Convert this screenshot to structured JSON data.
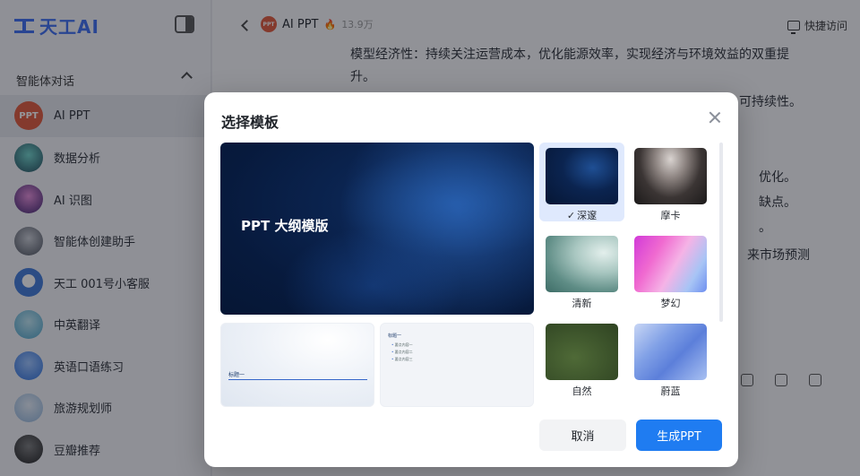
{
  "app": {
    "logo_text": "天工AI"
  },
  "sidebar": {
    "section_title": "智能体对话",
    "items": [
      {
        "label": "AI PPT",
        "avatar_text": "PPT",
        "color": "#e0583a",
        "active": true
      },
      {
        "label": "数据分析",
        "avatar_text": "",
        "color": "#2f6f72"
      },
      {
        "label": "AI 识图",
        "avatar_text": "",
        "color": "#6b3fa0"
      },
      {
        "label": "智能体创建助手",
        "avatar_text": "",
        "color": "#5a6272"
      },
      {
        "label": "天工 001号小客服",
        "avatar_text": "",
        "color": "#3f78d8"
      },
      {
        "label": "中英翻译",
        "avatar_text": "",
        "color": "#4aa3c8"
      },
      {
        "label": "英语口语练习",
        "avatar_text": "",
        "color": "#2d6fdb"
      },
      {
        "label": "旅游规划师",
        "avatar_text": "",
        "color": "#8fb3d9"
      },
      {
        "label": "豆瓣推荐",
        "avatar_text": "",
        "color": "#3a3a3a"
      }
    ]
  },
  "topbar": {
    "agent_name": "AI PPT",
    "agent_avatar": "PPT",
    "heat": "13.9万",
    "quick_access": "快捷访问"
  },
  "background_text": {
    "line1": "模型经济性：持续关注运营成本，优化能源效率，实现经济与环境效益的双重提",
    "line2": "升。",
    "line3": "可持续性。",
    "line4": "优化。",
    "line5": "缺点。",
    "line6": "。",
    "line7": "来市场预测"
  },
  "dialog": {
    "title": "选择模板",
    "preview": {
      "title": "PPT 大纲模版",
      "sub1_heading": "标题一",
      "sub2_heading": "标题一",
      "sub2_items": [
        "要点内容一",
        "要点内容二",
        "要点内容三"
      ]
    },
    "templates": [
      {
        "name": "深邃",
        "selected": true
      },
      {
        "name": "摩卡",
        "selected": false
      },
      {
        "name": "清新",
        "selected": false
      },
      {
        "name": "梦幻",
        "selected": false
      },
      {
        "name": "自然",
        "selected": false
      },
      {
        "name": "蔚蓝",
        "selected": false
      }
    ],
    "cancel_label": "取消",
    "generate_label": "生成PPT"
  },
  "colors": {
    "accent": "#1f7cf1",
    "brand": "#3b6cf0",
    "selected_bg": "#dfe9fd"
  }
}
